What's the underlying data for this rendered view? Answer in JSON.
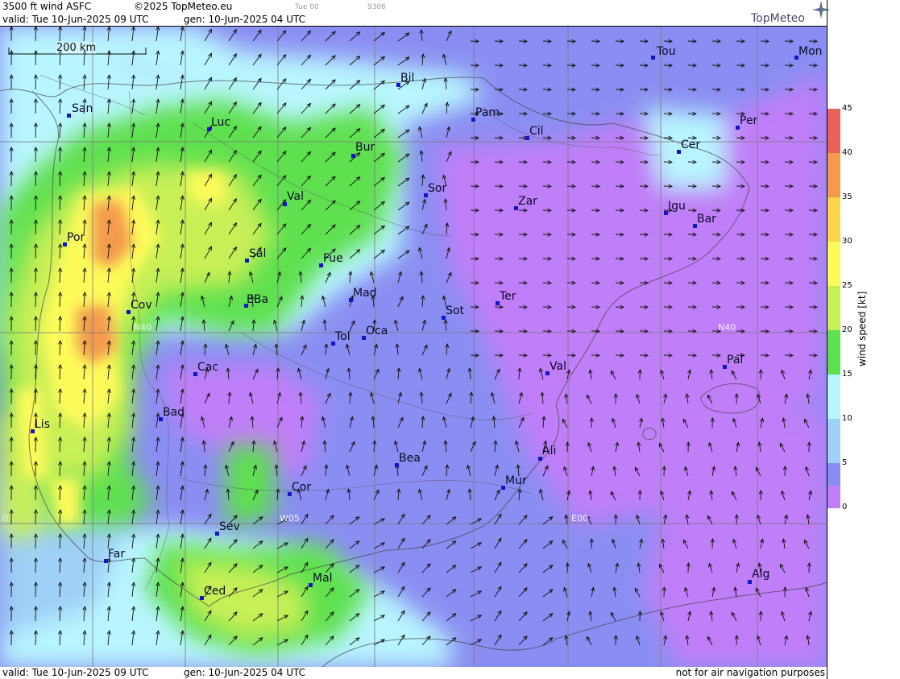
{
  "header": {
    "product": "3500 ft wind ASFC",
    "copyright": "©2025 TopMeteo.eu",
    "day_tag": "Tue 00",
    "code": "9306",
    "valid": "valid:  Tue  10-Jun-2025  09 UTC",
    "generated": "gen: 10-Jun-2025 04 UTC"
  },
  "logo": {
    "text": "TopMeteo",
    "icon": "compass-star-icon"
  },
  "scalebar": {
    "label": "200 km"
  },
  "cities": [
    {
      "name": "Tou"
    },
    {
      "name": "Mon"
    },
    {
      "name": "Bil"
    },
    {
      "name": "San"
    },
    {
      "name": "Pam"
    },
    {
      "name": "Luc"
    },
    {
      "name": "Cil"
    },
    {
      "name": "Per"
    },
    {
      "name": "Bur"
    },
    {
      "name": "Cer"
    },
    {
      "name": "Sor"
    },
    {
      "name": "Val"
    },
    {
      "name": "Zar"
    },
    {
      "name": "Igu"
    },
    {
      "name": "Bar"
    },
    {
      "name": "Por"
    },
    {
      "name": "Sal"
    },
    {
      "name": "Fue"
    },
    {
      "name": "Mad"
    },
    {
      "name": "Ter"
    },
    {
      "name": "Cov"
    },
    {
      "name": "EBa"
    },
    {
      "name": "Sot"
    },
    {
      "name": "Tol"
    },
    {
      "name": "Oca"
    },
    {
      "name": "Cac"
    },
    {
      "name": "Val"
    },
    {
      "name": "Pal"
    },
    {
      "name": "Bad"
    },
    {
      "name": "Lis"
    },
    {
      "name": "Ali"
    },
    {
      "name": "Bea"
    },
    {
      "name": "Cor"
    },
    {
      "name": "Mur"
    },
    {
      "name": "Sev"
    },
    {
      "name": "Far"
    },
    {
      "name": "Mal"
    },
    {
      "name": "Alg"
    },
    {
      "name": "Ced"
    }
  ],
  "grid_labels": [
    "N40",
    "N40",
    "W05",
    "E00",
    "0"
  ],
  "colorbar": {
    "title": "wind speed  [kt]",
    "ticks": [
      "45",
      "40",
      "35",
      "30",
      "25",
      "20",
      "15",
      "10",
      "5",
      "0"
    ],
    "colors": [
      "#e8625a",
      "#f39a4e",
      "#fdd34a",
      "#fdfb5a",
      "#c8ef56",
      "#5ee04f",
      "#b8f6ff",
      "#9fd0f7",
      "#8a8ef2",
      "#c07ef8"
    ]
  },
  "footer": {
    "valid": "valid:  Tue  10-Jun-2025  09 UTC",
    "generated": "gen: 10-Jun-2025 04 UTC",
    "note": "not for air navigation purposes"
  },
  "palette": {
    "very_low": "#c07ef8",
    "low": "#8a8ef2",
    "mid": "#9fd0f7",
    "mid_high": "#b8f6ff",
    "green": "#5ee04f",
    "lime": "#c8ef56",
    "yellow": "#fdfb5a",
    "orange": "#f39a4e"
  }
}
